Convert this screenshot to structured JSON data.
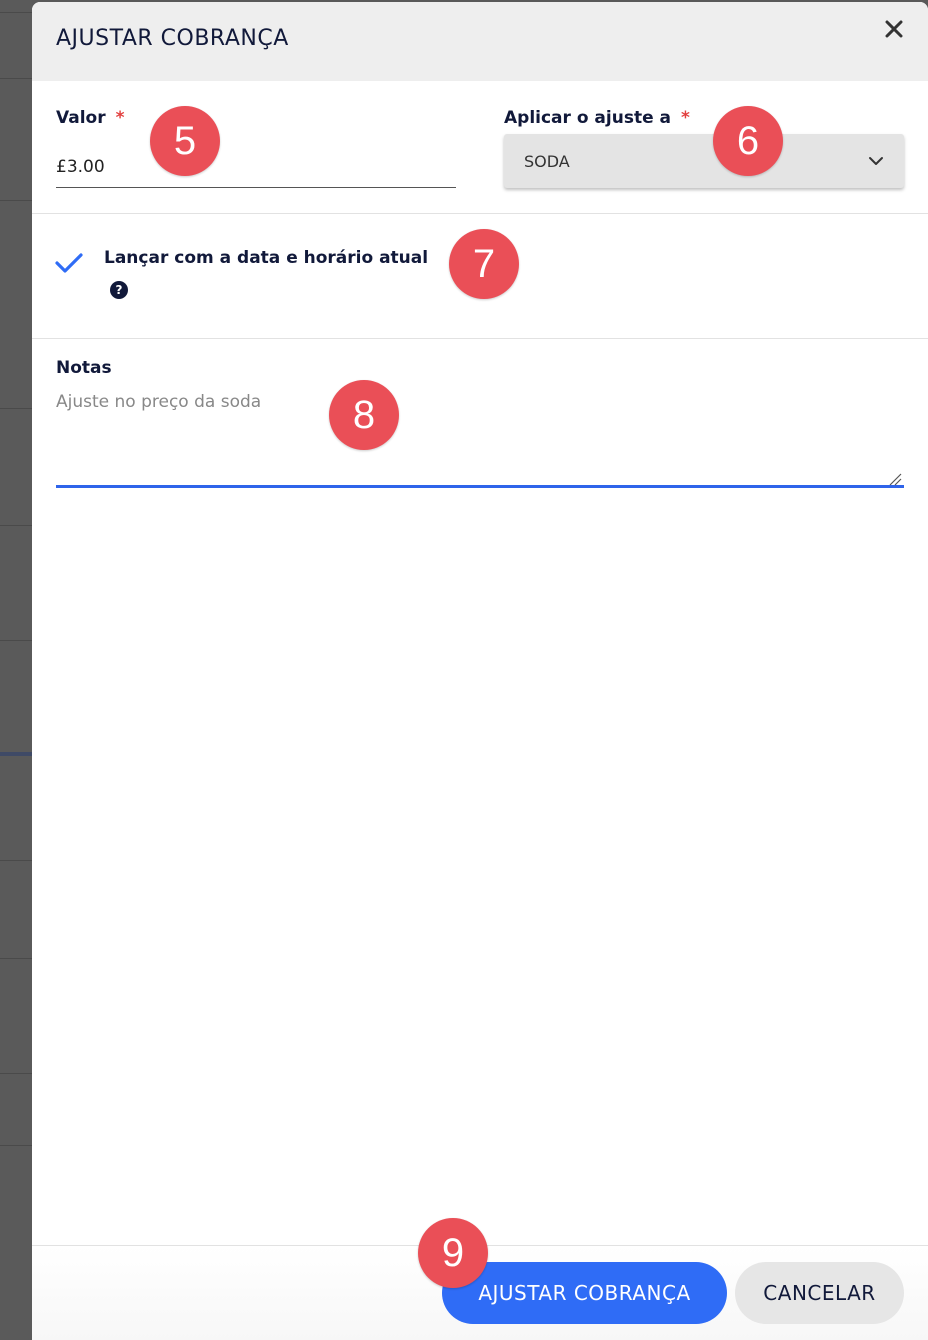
{
  "modal": {
    "title": "AJUSTAR COBRANÇA",
    "close_icon": "close-icon"
  },
  "form": {
    "valor": {
      "label": "Valor",
      "required_mark": "*",
      "value": "£3.00"
    },
    "aplicar": {
      "label": "Aplicar o ajuste a",
      "required_mark": "*",
      "selected": "SODA"
    },
    "checkbox": {
      "label": "Lançar com a data e horário atual",
      "checked": true,
      "help_glyph": "?"
    },
    "notas": {
      "label": "Notas",
      "placeholder": "Ajuste no preço da soda",
      "value": ""
    }
  },
  "footer": {
    "primary_label": "AJUSTAR COBRANÇA",
    "secondary_label": "CANCELAR"
  },
  "badges": [
    "5",
    "6",
    "7",
    "8",
    "9"
  ],
  "colors": {
    "primary": "#2f6cf6",
    "badge": "#ea4f57",
    "text_dark": "#11193a",
    "required": "#e2403f"
  }
}
